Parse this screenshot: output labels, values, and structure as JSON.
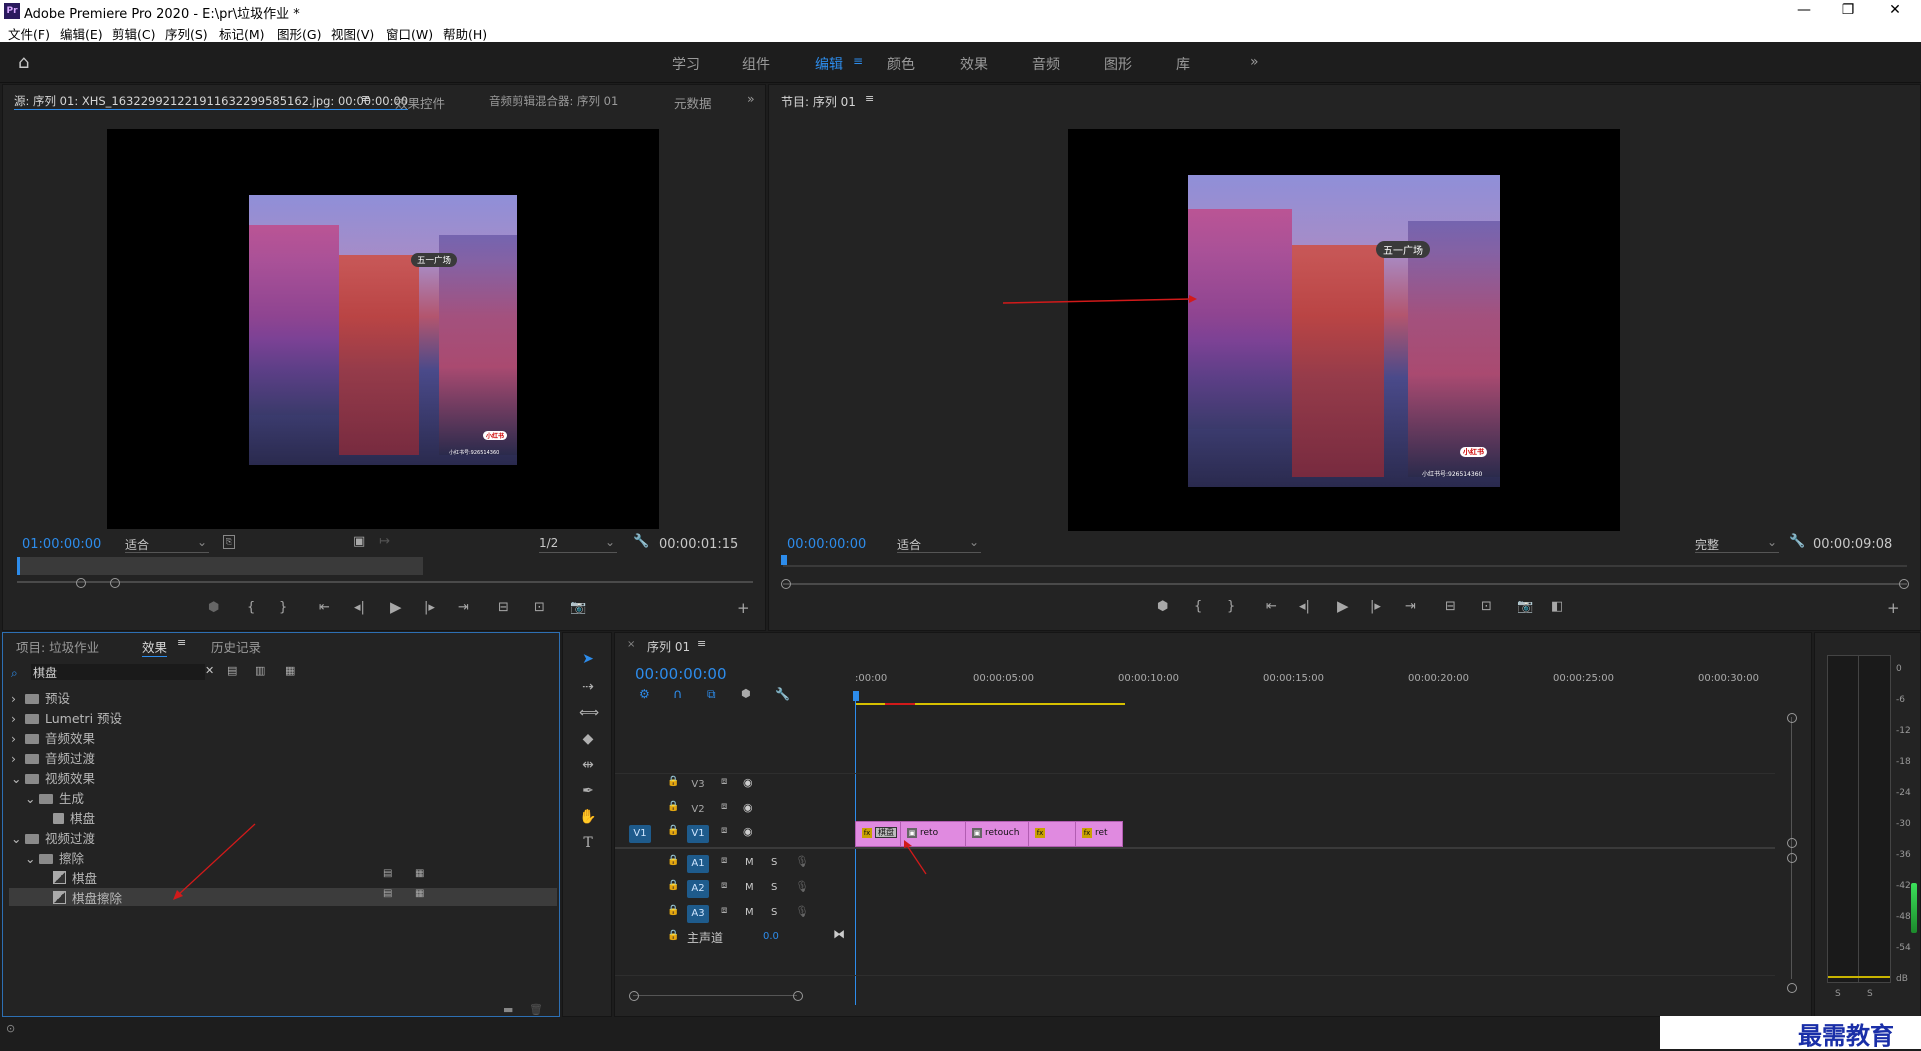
{
  "window": {
    "title": "Adobe Premiere Pro 2020 - E:\\pr\\垃圾作业 *",
    "logo": "Pr"
  },
  "menu": [
    "文件(F)",
    "编辑(E)",
    "剪辑(C)",
    "序列(S)",
    "标记(M)",
    "图形(G)",
    "视图(V)",
    "窗口(W)",
    "帮助(H)"
  ],
  "workspaces": {
    "items": [
      "学习",
      "组件",
      "编辑",
      "颜色",
      "效果",
      "音频",
      "图形",
      "库"
    ],
    "active": "编辑"
  },
  "source_panel": {
    "tabs": [
      "源: 序列 01: XHS_1632299212219116322995851​62.jpg: 00:00:00:00",
      "效果控件",
      "音频剪辑混合器: 序列 01",
      "元数据"
    ],
    "timecode_left": "01:00:00:00",
    "zoom": "适合",
    "resolution": "1/2",
    "timecode_right": "00:00:01:15",
    "image_text": [
      "五一广场",
      "小红书",
      "小红书号:926514360"
    ]
  },
  "program_panel": {
    "tab": "节目: 序列 01",
    "timecode_left": "00:00:00:00",
    "zoom": "适合",
    "quality": "完整",
    "timecode_right": "00:00:09:08",
    "image_text": [
      "五一广场",
      "小红书",
      "小红书号:926514360"
    ]
  },
  "project_panel": {
    "tabs": [
      "项目: 垃圾作业",
      "效果",
      "历史记录"
    ],
    "active_tab": "效果",
    "search_value": "棋盘",
    "tree": [
      {
        "label": "预设",
        "level": 0,
        "type": "folder",
        "expanded": false
      },
      {
        "label": "Lumetri 预设",
        "level": 0,
        "type": "folder",
        "expanded": false
      },
      {
        "label": "音频效果",
        "level": 0,
        "type": "folder",
        "expanded": false
      },
      {
        "label": "音频过渡",
        "level": 0,
        "type": "folder",
        "expanded": false
      },
      {
        "label": "视频效果",
        "level": 0,
        "type": "folder",
        "expanded": true
      },
      {
        "label": "生成",
        "level": 1,
        "type": "folder",
        "expanded": true
      },
      {
        "label": "棋盘",
        "level": 2,
        "type": "effect"
      },
      {
        "label": "视频过渡",
        "level": 0,
        "type": "folder",
        "expanded": true
      },
      {
        "label": "擦除",
        "level": 1,
        "type": "folder",
        "expanded": true
      },
      {
        "label": "棋盘",
        "level": 2,
        "type": "transition"
      },
      {
        "label": "棋盘擦除",
        "level": 2,
        "type": "transition",
        "selected": true
      }
    ]
  },
  "timeline": {
    "tab": "序列 01",
    "timecode": "00:00:00:00",
    "ruler_labels": [
      ":00:00",
      "00:00:05:00",
      "00:00:10:00",
      "00:00:15:00",
      "00:00:20:00",
      "00:00:25:00",
      "00:00:30:00"
    ],
    "video_tracks": [
      "V3",
      "V2",
      "V1"
    ],
    "source_patch": "V1",
    "audio_tracks": [
      "A1",
      "A2",
      "A3"
    ],
    "audio_buttons": {
      "mute": "M",
      "solo": "S"
    },
    "master": {
      "label": "主声道",
      "value": "0.0"
    },
    "clips": [
      "棋盘",
      "reto",
      "retouch",
      "ret"
    ]
  },
  "meter": {
    "labels": [
      "0",
      "-6",
      "-12",
      "-18",
      "-24",
      "-30",
      "-36",
      "-42",
      "-48",
      "-54",
      "dB"
    ],
    "solo": [
      "S",
      "S"
    ]
  },
  "watermark": "最需教育",
  "colors": {
    "accent": "#2d8ceb",
    "clip": "#e08ae0",
    "track_selected": "#1e5b8c"
  }
}
